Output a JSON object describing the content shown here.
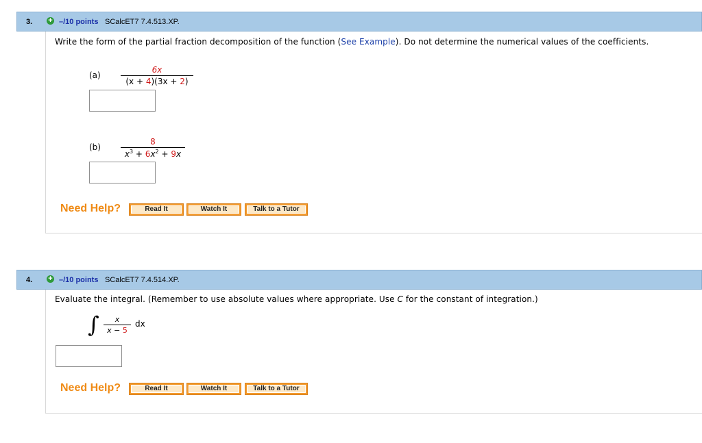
{
  "questions": [
    {
      "number": "3.",
      "points": "–/10 points",
      "code": "SCalcET7 7.4.513.XP.",
      "prompt_before_link": "Write the form of the partial fraction decomposition of the function (",
      "link": "See Example",
      "prompt_after_link": "). Do not determine the numerical values of the coefficients.",
      "parts": [
        {
          "label": "(a)",
          "numerator": "6x",
          "denominator": [
            "(x + ",
            "4",
            ")(3x + ",
            "2",
            ")"
          ]
        },
        {
          "label": "(b)",
          "numerator": "8",
          "denominator_text": "x3 + 6x2 + 9x"
        }
      ],
      "need_help": "Need Help?",
      "buttons": [
        "Read It",
        "Watch It",
        "Talk to a Tutor"
      ]
    },
    {
      "number": "4.",
      "points": "–/10 points",
      "code": "SCalcET7 7.4.514.XP.",
      "prompt_before_C": "Evaluate the integral. (Remember to use absolute values where appropriate. Use ",
      "C": "C",
      "prompt_after_C": " for the constant of integration.)",
      "integral": {
        "numerator": "x",
        "denominator_left": "x − ",
        "denominator_right": "5",
        "dx": "dx"
      },
      "need_help": "Need Help?",
      "buttons": [
        "Read It",
        "Watch It",
        "Talk to a Tutor"
      ]
    }
  ]
}
